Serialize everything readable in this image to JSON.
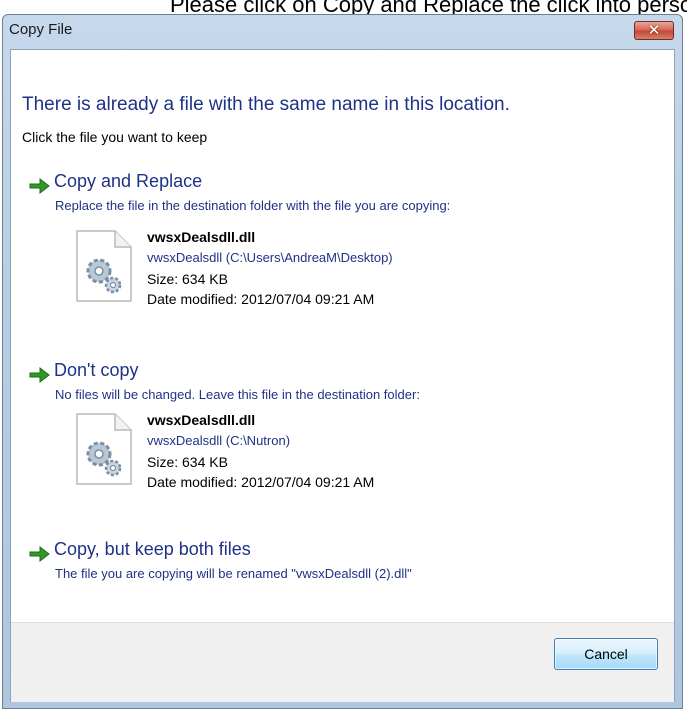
{
  "caption_text": "Please click on Copy and Replace the click into personal folder",
  "window": {
    "title": "Copy File",
    "close_glyph": "✕"
  },
  "dialog": {
    "heading": "There is already a file with the same name in this location.",
    "subheading": "Click the file you want to keep"
  },
  "options": [
    {
      "title": "Copy and Replace",
      "description": "Replace the file in the destination folder with the file you are copying:",
      "file": {
        "name": "vwsxDealsdll.dll",
        "path": "vwsxDealsdll (C:\\Users\\AndreaM\\Desktop)",
        "size": "Size: 634 KB",
        "date": "Date modified: 2012/07/04 09:21 AM"
      }
    },
    {
      "title": "Don't copy",
      "description": "No files will be changed. Leave this file in the destination folder:",
      "file": {
        "name": "vwsxDealsdll.dll",
        "path": "vwsxDealsdll (C:\\Nutron)",
        "size": "Size: 634 KB",
        "date": "Date modified: 2012/07/04 09:21 AM"
      }
    },
    {
      "title": "Copy, but keep both files",
      "description": "The file you are copying will be renamed \"vwsxDealsdll (2).dll\""
    }
  ],
  "footer": {
    "cancel_label": "Cancel"
  },
  "icons": {
    "option_arrow": "green-arrow-icon",
    "file": "dll-file-icon",
    "close": "close-icon"
  },
  "colors": {
    "link_blue": "#1e3287",
    "arrow_green": "#2f9a27",
    "close_red": "#c24a33"
  }
}
